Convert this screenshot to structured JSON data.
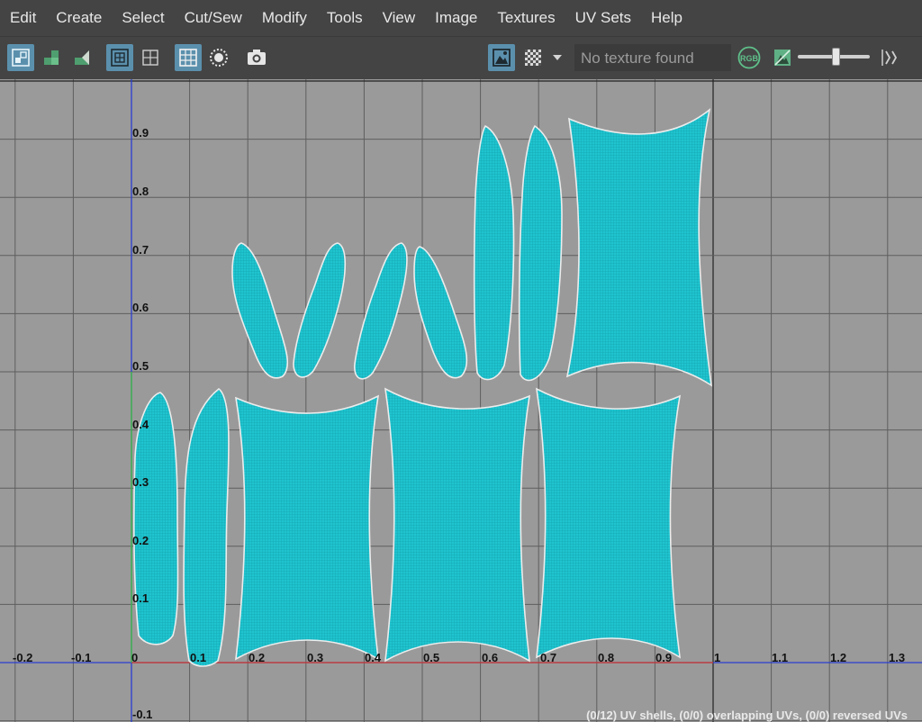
{
  "menu": {
    "items": [
      "Edit",
      "Create",
      "Select",
      "Cut/Sew",
      "Modify",
      "Tools",
      "View",
      "Image",
      "Textures",
      "UV Sets",
      "Help"
    ]
  },
  "toolbar": {
    "texture_field": "No texture found",
    "rgb_label": "RGB",
    "exposure_level": 0.52
  },
  "uv_grid": {
    "x_ticks": [
      "-0.2",
      "-0.1",
      "0",
      "0.1",
      "0.2",
      "0.3",
      "0.4",
      "0.5",
      "0.6",
      "0.7",
      "0.8",
      "0.9",
      "1",
      "1.1",
      "1.2",
      "1.3"
    ],
    "y_ticks": [
      "0.9",
      "0.8",
      "0.7",
      "0.6",
      "0.5",
      "0.4",
      "0.3",
      "0.2",
      "0.1",
      "-0.1"
    ],
    "shell_count": 12
  },
  "status": {
    "text": "(0/12) UV shells, (0/0) overlapping UVs, (0/0) reversed UVs"
  },
  "colors": {
    "menubar_bg": "#444444",
    "viewport_bg": "#9a9a9a",
    "shell_fill": "#1fc4cf",
    "active_button": "#5b90ad"
  }
}
